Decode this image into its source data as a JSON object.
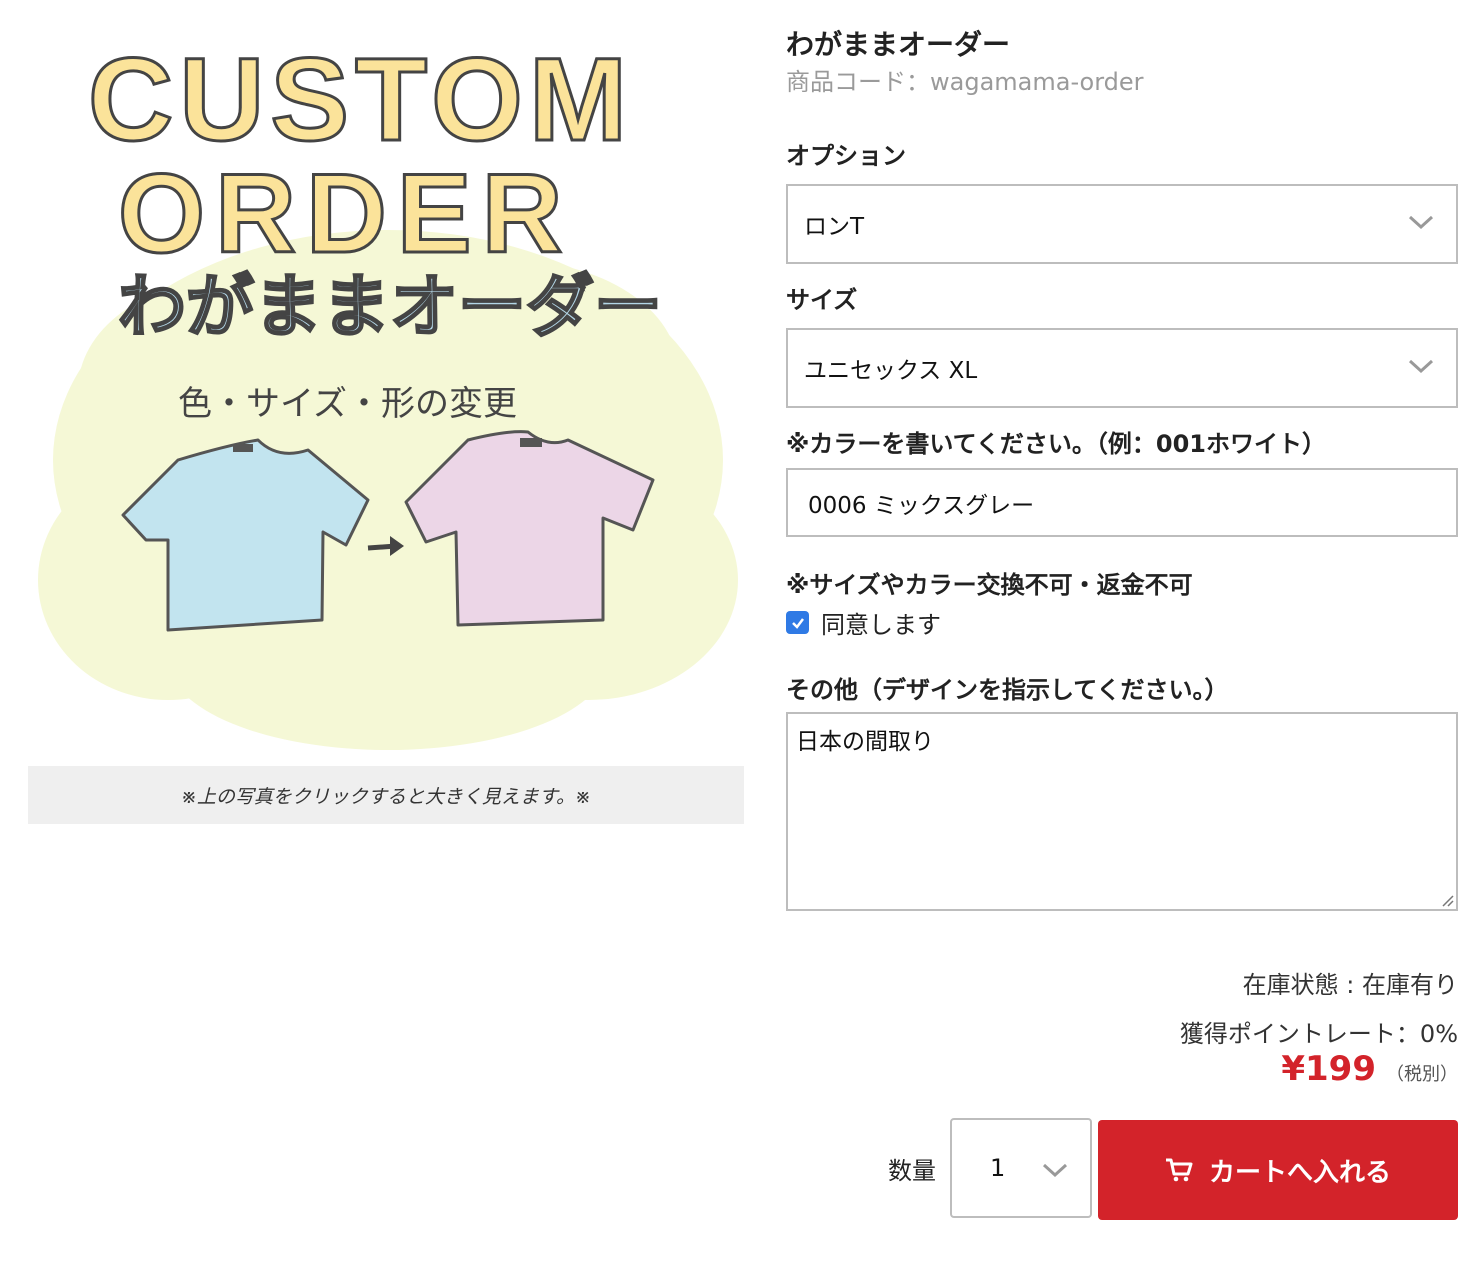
{
  "image": {
    "title_line1": "CUSTOM",
    "title_line2": "ORDER",
    "title_jp": "わがままオーダー",
    "subtitle": "色・サイズ・形の変更",
    "caption": "※上の写真をクリックすると大きく見えます。※"
  },
  "product": {
    "title": "わがままオーダー",
    "code": "商品コード：wagamama-order"
  },
  "form": {
    "option_label": "オプション",
    "option_value": "ロンT",
    "size_label": "サイズ",
    "size_value": "ユニセックス XL",
    "color_label": "※カラーを書いてください。（例：001ホワイト）",
    "color_value": "0006 ミックスグレー",
    "notice_label": "※サイズやカラー交換不可・返金不可",
    "agree_label": "同意します",
    "agree_checked": true,
    "other_label": "その他（デザインを指示してください。）",
    "other_value": "日本の間取り"
  },
  "info": {
    "stock": "在庫状態 : 在庫有り",
    "points": "獲得ポイントレート：0%",
    "price": "¥199",
    "tax": "（税別）"
  },
  "cart": {
    "qty_label": "数量",
    "qty_value": "1",
    "button_label": "カートへ入れる"
  },
  "colors": {
    "accent": "#d3232a",
    "checkbox": "#2f7ae5",
    "title_yellow": "#fbe39a",
    "title_blue": "#b3d6e6",
    "cloud": "#f5f8d6",
    "shirt_blue": "#c2e4ef",
    "shirt_pink": "#ecd6e7"
  }
}
